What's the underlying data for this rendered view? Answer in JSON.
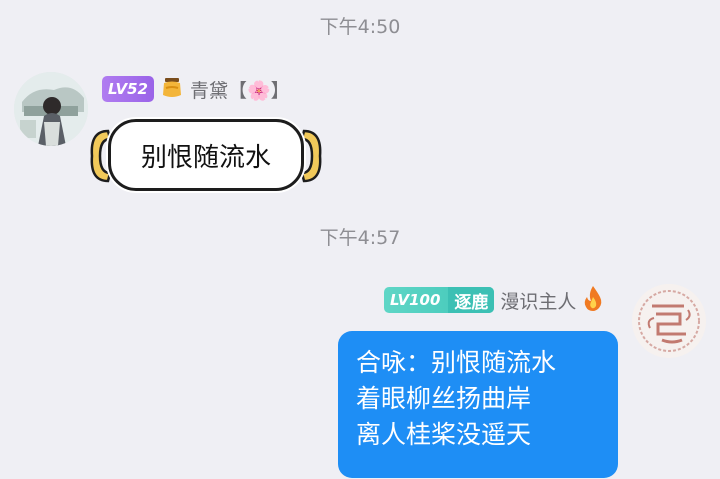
{
  "timestamps": [
    "下午4:50",
    "下午4:57"
  ],
  "left_message": {
    "level": "LV52",
    "badge_icon": "honey-jar-icon",
    "username": "青黛【🌸】",
    "text": "别恨随流水"
  },
  "right_message": {
    "level": "LV100",
    "title_tag": "逐鹿",
    "username": "漫识主人",
    "flame_icon": "flame-icon",
    "lines": [
      "合咏：别恨随流水",
      "着眼柳丝扬曲岸",
      "离人桂桨没遥天"
    ]
  },
  "colors": {
    "background": "#efeff4",
    "self_bubble": "#1e8ef5",
    "lv_purple": "#9a63e8",
    "lv_teal": "#40c6b8"
  }
}
